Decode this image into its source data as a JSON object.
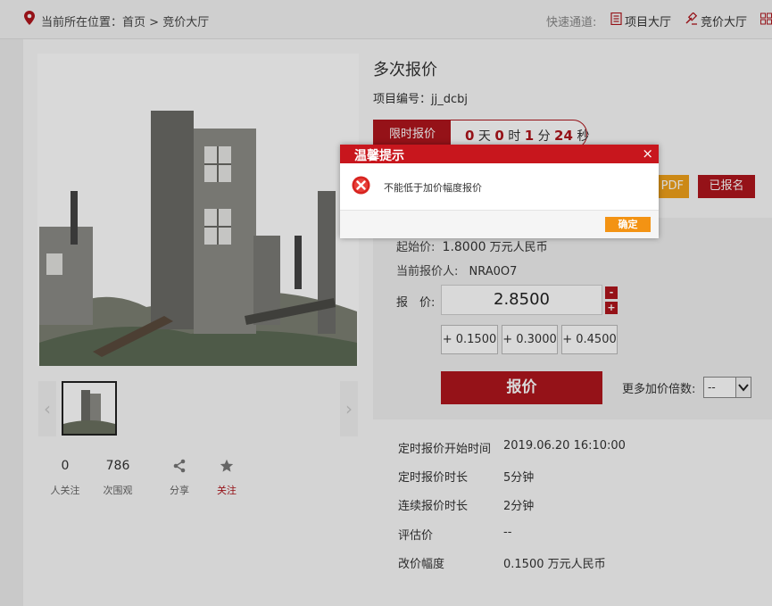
{
  "header": {
    "location_label": "当前所在位置：",
    "breadcrumb_home": "首页",
    "breadcrumb_sep": ">",
    "breadcrumb_current": "竞价大厅",
    "quick_label": "快速通道:",
    "quick_links": [
      "项目大厅",
      "竞价大厅"
    ]
  },
  "project": {
    "title": "多次报价",
    "code_label": "项目编号：",
    "code_value": "jj_dcbj",
    "limit_label": "限时报价",
    "countdown": {
      "days": "0",
      "day_unit": "天",
      "hours": "0",
      "hour_unit": "时",
      "minutes": "1",
      "minute_unit": "分",
      "seconds": "24",
      "second_unit": "秒"
    },
    "pdf_label": "PDF",
    "signed_label": "已报名"
  },
  "stats": {
    "followers": "0",
    "followers_label": "人关注",
    "views": "786",
    "views_label": "次围观",
    "share_label": "分享",
    "follow_label": "关注"
  },
  "bid": {
    "start_price_label": "起始价:",
    "start_price_value": "1.8000",
    "start_price_unit": "万元人民币",
    "current_bidder_label": "当前报价人:",
    "current_bidder_value": "NRA0O7",
    "price_label": "报　价:",
    "price_value": "2.8500",
    "minus": "-",
    "plus": "+",
    "increments": [
      "+ 0.1500",
      "+ 0.3000",
      "+ 0.4500"
    ],
    "submit_label": "报价",
    "more_label": "更多加价倍数:",
    "more_value": "--"
  },
  "details": [
    {
      "label": "定时报价开始时间",
      "value": "2019.06.20 16:10:00"
    },
    {
      "label": "定时报价时长",
      "value": "5分钟"
    },
    {
      "label": "连续报价时长",
      "value": "2分钟"
    },
    {
      "label": "评估价",
      "value": "--"
    },
    {
      "label": "改价幅度",
      "value": "0.1500 万元人民币"
    }
  ],
  "dialog": {
    "title": "温馨提示",
    "close": "×",
    "message": "不能低于加价幅度报价",
    "ok_label": "确定"
  },
  "colors": {
    "brand_red": "#b0161d",
    "dialog_red": "#c8161d",
    "orange": "#f39313"
  }
}
